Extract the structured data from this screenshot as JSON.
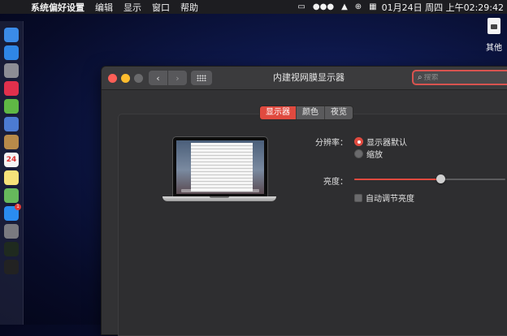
{
  "menubar": {
    "app_name": "系统偏好设置",
    "menus": [
      "编辑",
      "显示",
      "窗口",
      "帮助"
    ],
    "clock": "01月24日 周四 上午02:29:42"
  },
  "desktop": {
    "icon_label": "其他"
  },
  "window": {
    "title": "内建视网膜显示器",
    "search_placeholder": "搜索"
  },
  "tabs": [
    {
      "label": "显示器",
      "active": true
    },
    {
      "label": "颜色",
      "active": false
    },
    {
      "label": "夜览",
      "active": false
    }
  ],
  "display": {
    "resolution_label": "分辨率：",
    "resolution_options": [
      {
        "label": "显示器默认",
        "selected": true
      },
      {
        "label": "缩放",
        "selected": false
      }
    ],
    "brightness_label": "亮度：",
    "brightness_value": 0.57,
    "auto_brightness_label": "自动调节亮度",
    "auto_brightness_checked": false
  },
  "dock_apps": [
    {
      "icon": "finder-icon",
      "color": "#3b8be8"
    },
    {
      "icon": "safari-icon",
      "color": "#2f86e6"
    },
    {
      "icon": "launchpad-icon",
      "color": "#8d8d95"
    },
    {
      "icon": "music-icon",
      "color": "#e0304c"
    },
    {
      "icon": "android-icon",
      "color": "#5fb845"
    },
    {
      "icon": "preview-icon",
      "color": "#4c7bd2"
    },
    {
      "icon": "notes-brown-icon",
      "color": "#b88a4a"
    },
    {
      "icon": "calendar-icon",
      "color": "#f4f4f4",
      "text": "24"
    },
    {
      "icon": "notes-icon",
      "color": "#f6e27a"
    },
    {
      "icon": "maps-icon",
      "color": "#66b95c"
    },
    {
      "icon": "app-store-icon",
      "color": "#2a8cf0",
      "badge": "1"
    },
    {
      "icon": "system-preferences-icon",
      "color": "#7a7a80"
    },
    {
      "icon": "activity-monitor-icon",
      "color": "#1f2a1f"
    },
    {
      "icon": "terminal-icon",
      "color": "#222"
    }
  ]
}
